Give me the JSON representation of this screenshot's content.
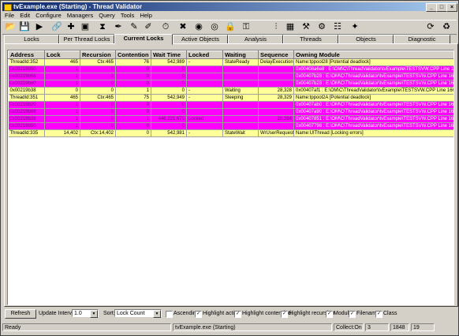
{
  "window": {
    "title": "tvExample.exe (Starting) - Thread Validator",
    "minimize": "_",
    "maximize": "□",
    "close": "×"
  },
  "menu": [
    "File",
    "Edit",
    "Configure",
    "Managers",
    "Query",
    "Tools",
    "Help"
  ],
  "toolbar_icons": [
    "open-icon",
    "save-icon",
    "launch-icon",
    "attach-icon",
    "inject-icon",
    "monitor-icon",
    "wait-icon",
    "pen-icon",
    "pencil-icon",
    "brush-icon",
    "stopwatch-icon",
    "stop-icon",
    "globe-icon",
    "target-icon",
    "lock-icon",
    "key-icon",
    "thread-icon",
    "chip-icon",
    "tools-icon",
    "gear-icon",
    "refresh-icon",
    "settings-icon"
  ],
  "tabs": [
    "Locks",
    "Per Thread Locks",
    "Current Locks",
    "Active Objects",
    "Analysis",
    "Threads",
    "Objects",
    "Diagnostic"
  ],
  "active_tab": "Current Locks",
  "table": {
    "columns": [
      "Address",
      "Lock",
      "Recursion",
      "Contention",
      "Wait Time",
      "Locked",
      "Waiting",
      "Sequence",
      "Owning Module"
    ],
    "rows": [
      {
        "style": "yellow",
        "cells": [
          "ThreadId:352",
          "465",
          "Ctx:465",
          "76",
          "542,989",
          "-",
          "StateReady",
          "DelayExecution",
          "Name:tppool28 [Potential deadlock]"
        ]
      },
      {
        "style": "magenta",
        "cells": [
          "0x00219b50",
          "1",
          "0",
          "0",
          "0",
          "",
          "",
          "",
          "0x00408a6e8 : E:\\OM\\C\\ThreadValidator\\tvExample\\TESTSVW.CPP Line 1681"
        ]
      },
      {
        "style": "magenta",
        "cells": [
          "0x00219b68",
          "1",
          "0",
          "0",
          "0",
          "",
          "",
          "",
          "0x00407b28 : E:\\OM\\C\\ThreadValidator\\tvExample\\TESTSVW.CPP Line 1679"
        ]
      },
      {
        "style": "magenta",
        "cells": [
          "0x00219b80",
          "1",
          "0",
          "0",
          "0",
          "",
          "",
          "",
          "0x00407b28 : E:\\OM\\C\\ThreadValidator\\tvExample\\TESTSVW.CPP Line 1677"
        ]
      },
      {
        "style": "yellow",
        "cells": [
          "0x00219b38",
          "0",
          "0",
          "1",
          "0",
          "-",
          "Waiting",
          "28,328",
          "0x00407af1 : E:\\OM\\C\\ThreadValidator\\tvExample\\TESTSVW.CPP Line 1668"
        ]
      },
      {
        "style": "yellow",
        "cells": [
          "ThreadId:351",
          "465",
          "Ctx:465",
          "75",
          "542,949",
          "-",
          "Sleeping",
          "28,329",
          "Name:tppool2A [Potential deadlock]"
        ]
      },
      {
        "style": "magenta",
        "cells": [
          "0x00219b20",
          "1",
          "0",
          "0",
          "0",
          "",
          "",
          "",
          "0x00407ab0 : E:\\OM\\C\\ThreadValidator\\tvExample\\TESTSVW.CPP Line 1642"
        ]
      },
      {
        "style": "magenta",
        "cells": [
          "0x00219b68",
          "1",
          "0",
          "0",
          "0",
          "",
          "",
          "",
          "0x00407a90 : E:\\OM\\C\\ThreadValidator\\tvExample\\TESTSVW.CPP Line 1640"
        ]
      },
      {
        "style": "magenta",
        "cells": [
          "0x00219b38",
          "1",
          "0",
          "1",
          "446,221,679",
          "Locked",
          "",
          "28,284",
          "0x00407851 : E:\\OM\\C\\ThreadValidator\\tvExample\\TESTSVW.CPP Line 1636"
        ]
      },
      {
        "style": "magenta",
        "cells": [
          "0x00219b50",
          "1",
          "0",
          "0",
          "0",
          "",
          "",
          "",
          "0x00407798 : E:\\OM\\C\\ThreadValidator\\tvExample\\TESTSVW.CPP Line 1636"
        ]
      },
      {
        "style": "yellow",
        "cells": [
          "ThreadId:335",
          "14,402",
          "Ctx:14,402",
          "0",
          "542,981",
          "-",
          "StateWait",
          "WrUserRequest",
          "Name:UIThread [Locking errors]"
        ]
      }
    ]
  },
  "bottom": {
    "refresh": "Refresh",
    "update_interval_label": "Update Interval:",
    "update_interval_value": "1.0",
    "sort_label": "Sort:",
    "sort_value": "Lock Count",
    "checks": [
      {
        "label": "Ascending",
        "checked": false
      },
      {
        "label": "Highlight active",
        "checked": true
      },
      {
        "label": "Highlight contended",
        "checked": true
      },
      {
        "label": "Highlight recursion",
        "checked": true
      },
      {
        "label": "Module",
        "checked": true
      },
      {
        "label": "Filename",
        "checked": true
      },
      {
        "label": "Class",
        "checked": true
      }
    ],
    "check_mark": "✓"
  },
  "status": [
    "Ready",
    "tvExample.exe (Starting)",
    "Collect:On",
    "3",
    "1848",
    "19"
  ],
  "colors": {
    "highlight_yellow": "#ffff99",
    "highlight_magenta": "#ff00ff",
    "title_blue": "#0a246a"
  }
}
